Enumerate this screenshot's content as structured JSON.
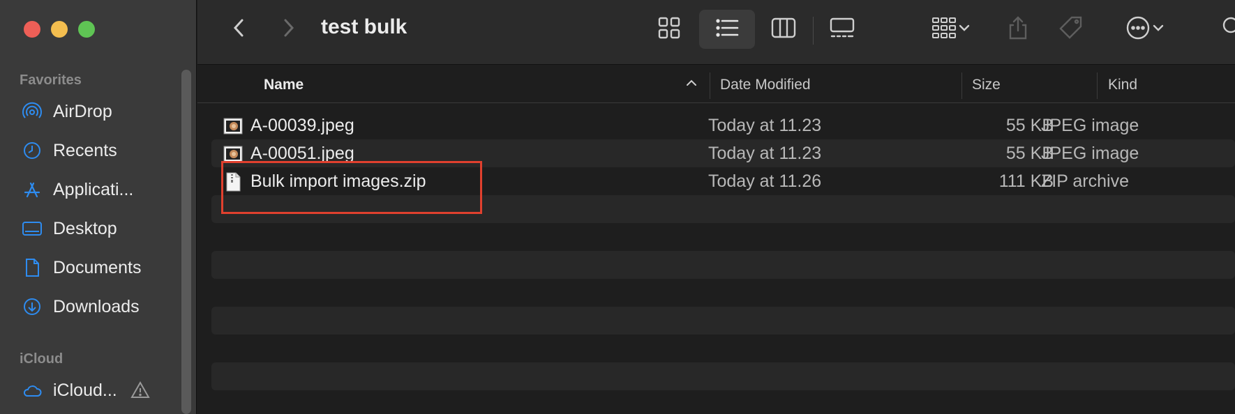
{
  "window": {
    "title": "test bulk"
  },
  "sidebar": {
    "sections": [
      {
        "heading": "Favorites",
        "items": [
          {
            "label": "AirDrop",
            "icon": "airdrop-icon"
          },
          {
            "label": "Recents",
            "icon": "clock-icon"
          },
          {
            "label": "Applicati...",
            "icon": "applications-icon"
          },
          {
            "label": "Desktop",
            "icon": "desktop-icon"
          },
          {
            "label": "Documents",
            "icon": "document-icon"
          },
          {
            "label": "Downloads",
            "icon": "download-icon"
          }
        ]
      },
      {
        "heading": "iCloud",
        "items": [
          {
            "label": "iCloud...",
            "icon": "cloud-icon"
          }
        ]
      }
    ]
  },
  "columns": {
    "name": "Name",
    "date": "Date Modified",
    "size": "Size",
    "kind": "Kind"
  },
  "files": [
    {
      "name": "A-00039.jpeg",
      "date": "Today at 11.23",
      "size": "55 KB",
      "kind": "JPEG image",
      "icon": "jpeg-file-icon"
    },
    {
      "name": "A-00051.jpeg",
      "date": "Today at 11.23",
      "size": "55 KB",
      "kind": "JPEG image",
      "icon": "jpeg-file-icon"
    },
    {
      "name": "Bulk import images.zip",
      "date": "Today at 11.26",
      "size": "111 KB",
      "kind": "ZIP archive",
      "icon": "zip-file-icon"
    }
  ],
  "colors": {
    "accent": "#2e8cf0",
    "highlight": "#e0402e"
  }
}
